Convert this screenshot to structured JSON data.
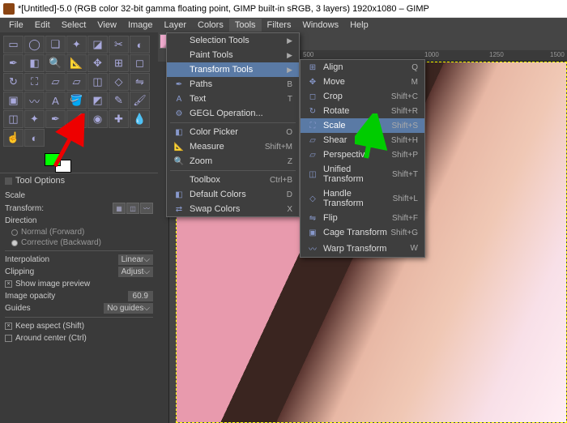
{
  "title": "*[Untitled]-5.0 (RGB color 32-bit gamma floating point, GIMP built-in sRGB, 3 layers) 1920x1080 – GIMP",
  "menubar": [
    "File",
    "Edit",
    "Select",
    "View",
    "Image",
    "Layer",
    "Colors",
    "Tools",
    "Filters",
    "Windows",
    "Help"
  ],
  "activeMenu": "Tools",
  "toolsMenu": [
    {
      "label": "Selection Tools",
      "arrow": true
    },
    {
      "label": "Paint Tools",
      "arrow": true
    },
    {
      "label": "Transform Tools",
      "arrow": true,
      "hl": true
    },
    {
      "label": "Paths",
      "shortcut": "B",
      "ico": "✒"
    },
    {
      "label": "Text",
      "shortcut": "T",
      "ico": "A"
    },
    {
      "label": "GEGL Operation...",
      "ico": "⚙"
    },
    {
      "sep": true
    },
    {
      "label": "Color Picker",
      "shortcut": "O",
      "ico": "◧"
    },
    {
      "label": "Measure",
      "shortcut": "Shift+M",
      "ico": "📐"
    },
    {
      "label": "Zoom",
      "shortcut": "Z",
      "ico": "🔍"
    },
    {
      "sep": true
    },
    {
      "label": "Toolbox",
      "shortcut": "Ctrl+B"
    },
    {
      "label": "Default Colors",
      "shortcut": "D",
      "ico": "◧"
    },
    {
      "label": "Swap Colors",
      "shortcut": "X",
      "ico": "⇄"
    }
  ],
  "transformMenu": [
    {
      "label": "Align",
      "shortcut": "Q",
      "ico": "⊞"
    },
    {
      "label": "Move",
      "shortcut": "M",
      "ico": "✥"
    },
    {
      "label": "Crop",
      "shortcut": "Shift+C",
      "ico": "◻"
    },
    {
      "label": "Rotate",
      "shortcut": "Shift+R",
      "ico": "↻"
    },
    {
      "label": "Scale",
      "shortcut": "Shift+S",
      "ico": "⛶",
      "hl": true
    },
    {
      "label": "Shear",
      "shortcut": "Shift+H",
      "ico": "▱"
    },
    {
      "label": "Perspective",
      "shortcut": "Shift+P",
      "ico": "▱"
    },
    {
      "label": "Unified Transform",
      "shortcut": "Shift+T",
      "ico": "◫"
    },
    {
      "label": "Handle Transform",
      "shortcut": "Shift+L",
      "ico": "◇"
    },
    {
      "label": "Flip",
      "shortcut": "Shift+F",
      "ico": "⇋"
    },
    {
      "label": "Cage Transform",
      "shortcut": "Shift+G",
      "ico": "▣"
    },
    {
      "label": "Warp Transform",
      "shortcut": "W",
      "ico": "〰"
    }
  ],
  "toolOptions": {
    "title": "Tool Options",
    "toolName": "Scale",
    "transformLabel": "Transform:",
    "directionLabel": "Direction",
    "dirNormal": "Normal (Forward)",
    "dirCorrective": "Corrective (Backward)",
    "interpLabel": "Interpolation",
    "interpVal": "Linear",
    "clipLabel": "Clipping",
    "clipVal": "Adjust",
    "showPreview": "Show image preview",
    "opacityLabel": "Image opacity",
    "opacityVal": "60.9",
    "guidesLabel": "Guides",
    "guidesVal": "No guides",
    "keepAspect": "Keep aspect (Shift)",
    "aroundCenter": "Around center (Ctrl)"
  },
  "ruler": {
    "t1": "500",
    "t2": "1000",
    "t3": "1250",
    "t4": "1500"
  },
  "colors": {
    "fg": "#00ff00",
    "bg": "#ffffff"
  }
}
